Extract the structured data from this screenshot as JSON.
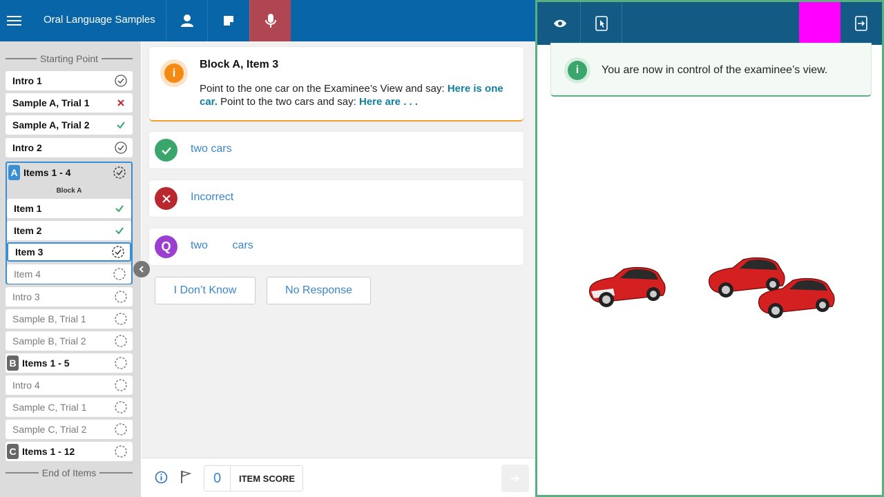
{
  "header": {
    "app_title": "Oral Language Samples",
    "icons": [
      "menu-icon",
      "person-icon",
      "note-icon",
      "microphone-icon"
    ]
  },
  "sidebar": {
    "start_label": "Starting Point",
    "end_label": "End of Items",
    "items": [
      {
        "label": "Intro 1",
        "status": "complete"
      },
      {
        "label": "Sample A, Trial 1",
        "status": "incorrect"
      },
      {
        "label": "Sample A, Trial 2",
        "status": "correct"
      },
      {
        "label": "Intro 2",
        "status": "complete"
      },
      {
        "label": "Intro 3",
        "status": "not-started"
      },
      {
        "label": "Sample B, Trial 1",
        "status": "not-started"
      },
      {
        "label": "Sample B, Trial 2",
        "status": "not-started"
      },
      {
        "label": "Intro 4",
        "status": "not-started"
      },
      {
        "label": "Sample C, Trial 1",
        "status": "not-started"
      },
      {
        "label": "Sample C, Trial 2",
        "status": "not-started"
      }
    ],
    "block_a": {
      "badge": "A",
      "label": "Items 1 - 4",
      "sublabel": "Block A",
      "color": "#3a8ed4",
      "items": [
        {
          "label": "Item 1",
          "status": "correct"
        },
        {
          "label": "Item 2",
          "status": "correct"
        },
        {
          "label": "Item 3",
          "status": "in-progress"
        },
        {
          "label": "Item 4",
          "status": "not-started"
        }
      ]
    },
    "block_b": {
      "badge": "B",
      "label": "Items 1 - 5",
      "color": "#666666"
    },
    "block_c": {
      "badge": "C",
      "label": "Items 1 - 12",
      "color": "#666666"
    }
  },
  "item": {
    "title": "Block A, Item 3",
    "instruction_1": "Point to the one car on the Examinee’s View and say: ",
    "instruction_2": "Here is one car.",
    "instruction_3": " Point to the two cars and say: ",
    "instruction_4": "Here are . . ."
  },
  "responses": [
    {
      "label": "two cars",
      "icon": "check-icon",
      "color": "#3aa66c"
    },
    {
      "label": "Incorrect",
      "icon": "x-icon",
      "color": "#b8282e"
    },
    {
      "label": "two        cars",
      "icon": "Q",
      "color": "#9b3fd0"
    }
  ],
  "options": {
    "dont_know": "I Don’t Know",
    "no_response": "No Response"
  },
  "footer": {
    "score_value": "0",
    "score_label": "ITEM SCORE"
  },
  "examinee_view": {
    "notice_text": "You are now in control of the examinee’s view.",
    "highlight_color": "#ff00ff",
    "car_groups": [
      1,
      2
    ]
  }
}
